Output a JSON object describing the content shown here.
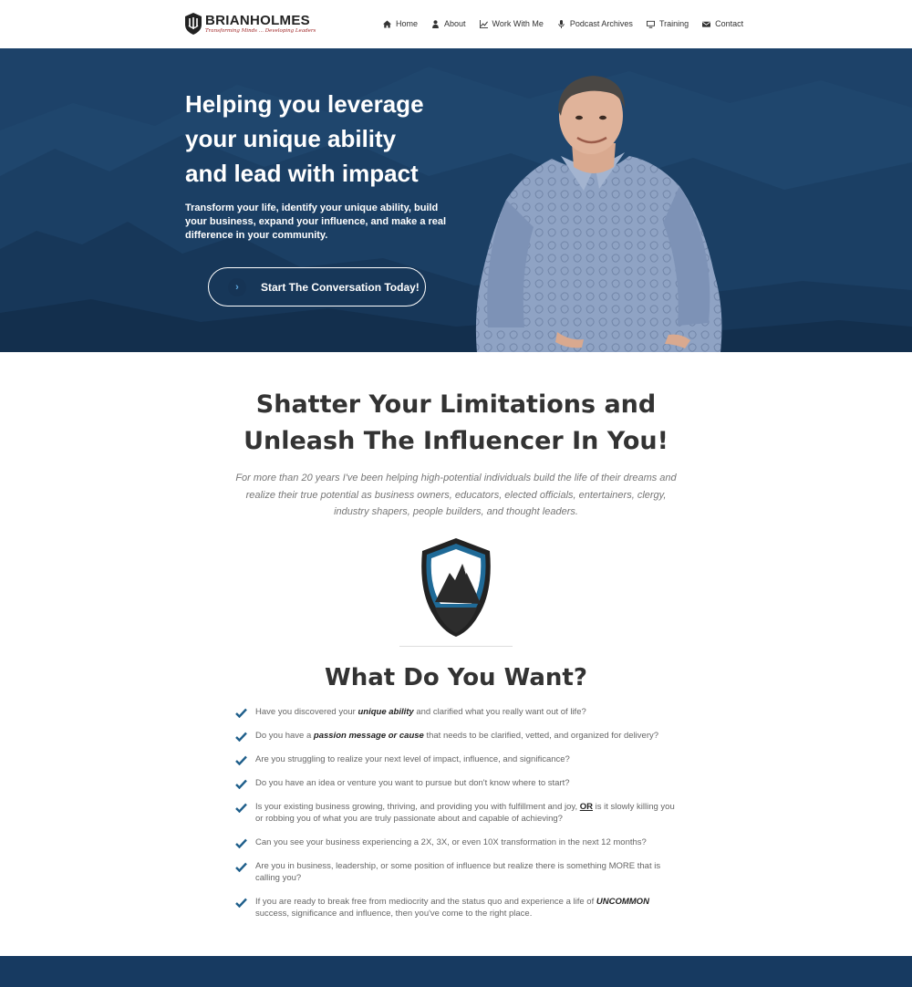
{
  "brand": {
    "name": "BRIANHOLMES",
    "tagline": "Transforming Minds ... Developing Leaders"
  },
  "nav": {
    "items": [
      {
        "label": "Home",
        "icon": "home-icon"
      },
      {
        "label": "About",
        "icon": "user-icon"
      },
      {
        "label": "Work With Me",
        "icon": "chart-icon"
      },
      {
        "label": "Podcast Archives",
        "icon": "microphone-icon"
      },
      {
        "label": "Training",
        "icon": "monitor-icon"
      },
      {
        "label": "Contact",
        "icon": "envelope-icon"
      }
    ]
  },
  "hero": {
    "title_lines": [
      "Helping you leverage",
      "your unique ability",
      "and lead with impact"
    ],
    "subtitle": "Transform your life, identify your unique ability, build your business, expand your influence, and make a real difference in your community.",
    "cta_label": "Start The Conversation Today!",
    "cta_icon": "chevron-right-icon"
  },
  "intro": {
    "title_lines": [
      "Shatter Your Limitations and",
      "Unleash The Influencer In You!"
    ],
    "description": "For more than 20 years I've been helping high-potential individuals build the life of their dreams and realize their true potential as business owners, educators, elected officials, entertainers, clergy, industry shapers, people builders, and thought leaders."
  },
  "wants": {
    "title": "What Do You Want?",
    "items": [
      {
        "before": "Have you discovered your ",
        "em": "unique ability",
        "after": " and clarified what you really want out of life?"
      },
      {
        "before": "Do you have a ",
        "em": "passion message or cause",
        "after": " that needs to be clarified, vetted, and organized for delivery?"
      },
      {
        "before": "Are you struggling to realize your next level of impact, influence, and significance?",
        "em": "",
        "after": ""
      },
      {
        "before": "Do you have an idea or venture you want to pursue but don't know where to start?",
        "em": "",
        "after": ""
      },
      {
        "before": "Is your existing business growing, thriving, and providing you with fulfillment and joy, ",
        "em": "OR",
        "after": " is it slowly killing you or robbing you of what you are truly passionate about and capable of achieving?"
      },
      {
        "before": "Can you see your business experiencing a 2X, 3X, or even 10X transformation in the next 12 months?",
        "em": "",
        "after": ""
      },
      {
        "before": "Are you in business, leadership, or some position of influence but realize there is something MORE that is calling you?",
        "em": "",
        "after": ""
      },
      {
        "before": "If you are ready to break free from mediocrity and the status quo and experience a life of ",
        "em": "UNCOMMON",
        "after": " success, significance and influence, then you've come to the right place."
      }
    ]
  },
  "colors": {
    "hero_bg": "#1c4168",
    "accent_blue": "#1f5f8b",
    "footer_band": "#173a61"
  }
}
